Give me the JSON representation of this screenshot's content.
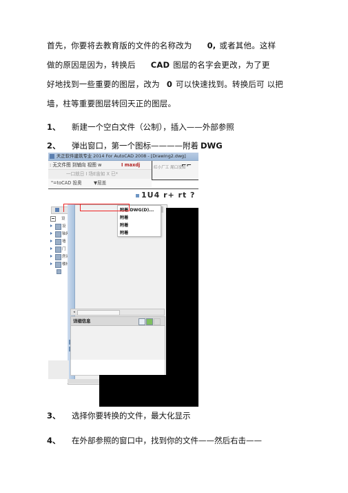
{
  "document": {
    "paragraphs": [
      {
        "id": "p1",
        "segments": [
          "首先，你要将去教育版的文件的名称改为",
          "0,",
          "或者其他。这样"
        ]
      },
      {
        "id": "p2",
        "segments": [
          "做的原因是因为，转换后",
          "CAD",
          "图层的名字会更改，为了更"
        ]
      },
      {
        "id": "p3",
        "segments": [
          "好地找到一些重要的图层，改为",
          "0",
          "可以快速找到。转换后可 以把"
        ]
      },
      {
        "id": "p4",
        "segments": [
          "墙，柱等重要图层转回天正的图层。",
          "",
          ""
        ]
      }
    ],
    "steps": [
      {
        "num": "1、",
        "text": "新建一个空白文件（公制），插入——外部参照",
        "bold_tail": ""
      },
      {
        "num": "2、",
        "text": "弹出窗口，第一个图标————附着",
        "bold_tail": "DWG"
      },
      {
        "num": "3、",
        "text": "选择你要转换的文件，最大化显示",
        "bold_tail": ""
      },
      {
        "num": "4、",
        "text": "在外部参照的窗口中，找到你的文件",
        "bold_tail": "",
        "suffix": "——然后右击——"
      }
    ]
  },
  "screenshot": {
    "title_bar": {
      "text": "天正软件建筑专业 2014 For AutoCAD 2008 - [Drawing2.dwg]",
      "icon": "app-icon"
    },
    "menu_bar": {
      "text": ": 无文件图 到辅向 视图 w",
      "highlight": "I maxdj"
    },
    "toolbar2": {
      "text": "一口就日 I 场E宙如 X 已*"
    },
    "toolbar3": {
      "left": "\"=toCAD 投奥",
      "right": "▼屈盖"
    },
    "right_panel": {
      "text": "红小厂工 尾口没如",
      "glyph": "⌐⌐"
    },
    "big_toolbar_row": {
      "text": "1U4 r+ rt ?"
    },
    "tree": {
      "items": [
        {
          "label": "设",
          "expander": "minus"
        },
        {
          "label": "设",
          "expander": "arrow"
        },
        {
          "label": "轴网",
          "expander": "arrow"
        },
        {
          "label": "墙",
          "expander": "arrow"
        },
        {
          "label": "门",
          "expander": "arrow"
        },
        {
          "label": "房间",
          "expander": "arrow"
        },
        {
          "label": "楼梯",
          "expander": "arrow"
        }
      ]
    },
    "context_menu": {
      "items": [
        "附着 DWG(D)...",
        "附着",
        "附着",
        "附着"
      ],
      "highlighted_index": 0,
      "highlight_color": "#ee2222"
    },
    "details_panel": {
      "title": "详细信息"
    },
    "scrollbar": {
      "left_arrow": "◂"
    }
  }
}
